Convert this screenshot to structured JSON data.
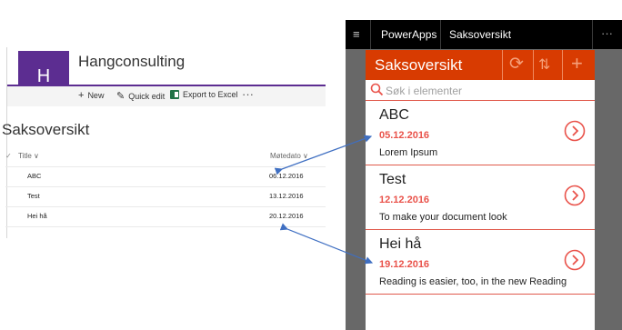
{
  "sharepoint": {
    "logo_letter": "H",
    "site_title": "Hangconsulting",
    "commands": {
      "new": "New",
      "quick_edit": "Quick edit",
      "export": "Export to Excel",
      "more": "···"
    },
    "list_title": "Saksoversikt",
    "columns": {
      "title": "Title ∨",
      "date": "Møtedato ∨"
    },
    "rows": [
      {
        "title": "ABC",
        "date": "06.12.2016"
      },
      {
        "title": "Test",
        "date": "13.12.2016"
      },
      {
        "title": "Hei hå",
        "date": "20.12.2016"
      }
    ]
  },
  "powerapps": {
    "topbar": {
      "menu_icon": "≡",
      "tab1": "PowerApps",
      "tab2": "Saksoversikt",
      "more": "···"
    },
    "header_title": "Saksoversikt",
    "header_icons": [
      "refresh-icon",
      "sort-icon",
      "add-icon"
    ],
    "search_placeholder": "Søk i elementer",
    "items": [
      {
        "title": "ABC",
        "date": "05.12.2016",
        "text": "Lorem Ipsum"
      },
      {
        "title": "Test",
        "date": "12.12.2016",
        "text": "To make your document look"
      },
      {
        "title": "Hei hå",
        "date": "19.12.2016",
        "text": "Reading is easier, too, in the new Reading"
      }
    ]
  },
  "colors": {
    "accent_red": "#d83b01",
    "date_red": "#e9524a",
    "sharepoint_purple": "#5c2d91",
    "arrow_blue": "#3f6fc2"
  }
}
